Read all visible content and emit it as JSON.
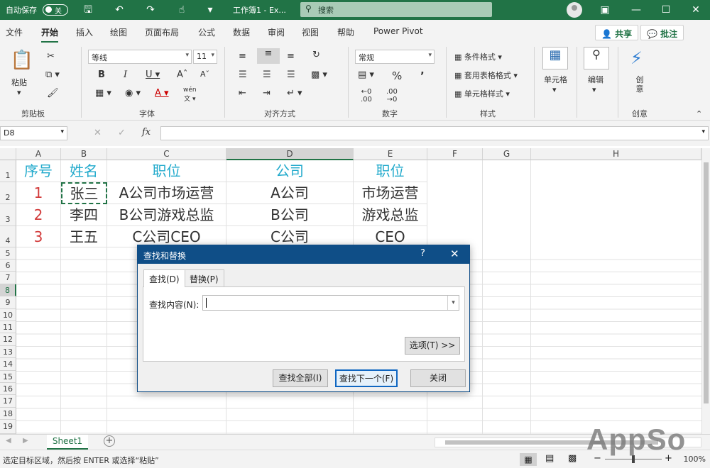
{
  "titlebar": {
    "autosave": "自动保存",
    "autosave_state": "关",
    "filename": "工作簿1 - Ex...",
    "search_placeholder": "搜索"
  },
  "menu": [
    "文件",
    "开始",
    "插入",
    "绘图",
    "页面布局",
    "公式",
    "数据",
    "审阅",
    "视图",
    "帮助",
    "Power Pivot"
  ],
  "share": "共享",
  "comments": "批注",
  "ribbon": {
    "paste": "粘贴",
    "clipboard": "剪贴板",
    "font_name": "等线",
    "font_size": "11",
    "font": "字体",
    "alignment": "对齐方式",
    "number_format": "常规",
    "number": "数字",
    "cond_format": "条件格式",
    "table_format": "套用表格格式",
    "cell_style": "单元格样式",
    "styles": "样式",
    "cells": "单元格",
    "editing": "编辑",
    "creative": "创意",
    "creative_group": "创意"
  },
  "name_box": "D8",
  "columns": [
    "A",
    "B",
    "C",
    "D",
    "E",
    "F",
    "G",
    "H"
  ],
  "rows": [
    "1",
    "2",
    "3",
    "4",
    "5",
    "6",
    "7",
    "8",
    "9",
    "10",
    "11",
    "12",
    "13",
    "14",
    "15",
    "16",
    "17",
    "18",
    "19"
  ],
  "cells": {
    "r1": [
      "序号",
      "姓名",
      "职位",
      "公司",
      "职位"
    ],
    "r2": [
      "1",
      "张三",
      "A公司市场运营",
      "A公司",
      "市场运营"
    ],
    "r3": [
      "2",
      "李四",
      "B公司游戏总监",
      "B公司",
      "游戏总监"
    ],
    "r4": [
      "3",
      "王五",
      "C公司CEO",
      "C公司",
      "CEO"
    ]
  },
  "sheet_tab": "Sheet1",
  "status": "选定目标区域，然后按 ENTER 或选择“粘贴”",
  "zoom": "100%",
  "dialog": {
    "title": "查找和替换",
    "help": "?",
    "tab_find": "查找(D)",
    "tab_replace": "替换(P)",
    "find_label": "查找内容(N):",
    "find_value": "",
    "options": "选项(T) >>",
    "find_all": "查找全部(I)",
    "find_next": "查找下一个(F)",
    "close": "关闭"
  },
  "watermark": "AppSo"
}
